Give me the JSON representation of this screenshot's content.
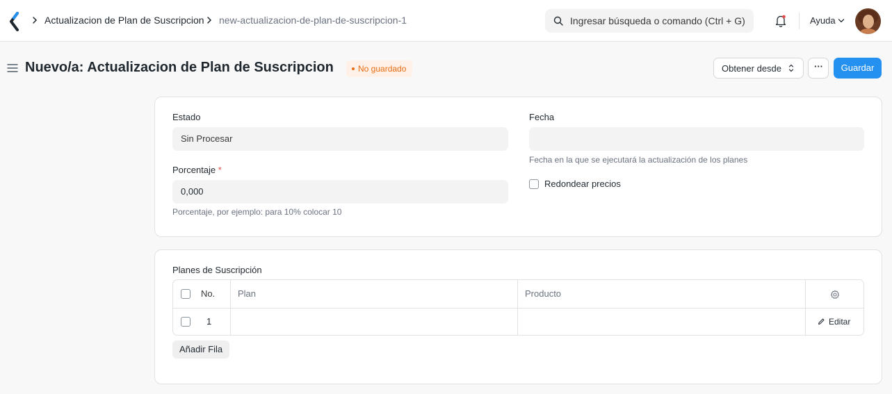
{
  "navbar": {
    "breadcrumbs": [
      "Actualizacion de Plan de Suscripcion",
      "new-actualizacion-de-plan-de-suscripcion-1"
    ],
    "search_placeholder": "Ingresar búsqueda o comando (Ctrl + G)",
    "help_label": "Ayuda"
  },
  "page": {
    "title": "Nuevo/a: Actualizacion de Plan de Suscripcion",
    "status_badge": "No guardado",
    "get_from_label": "Obtener desde",
    "more_label": "···",
    "save_label": "Guardar"
  },
  "form": {
    "estado_label": "Estado",
    "estado_value": "Sin Procesar",
    "porcentaje_label": "Porcentaje",
    "porcentaje_required": "*",
    "porcentaje_value": "0,000",
    "porcentaje_help": "Porcentaje, por ejemplo: para 10% colocar 10",
    "fecha_label": "Fecha",
    "fecha_value": "",
    "fecha_help": "Fecha en la que se ejecutará la actualización de los planes",
    "redondear_label": "Redondear precios",
    "redondear_checked": false
  },
  "table": {
    "section_label": "Planes de Suscripción",
    "columns": [
      "No.",
      "Plan",
      "Producto"
    ],
    "rows": [
      {
        "no": "1",
        "plan": "",
        "producto": ""
      }
    ],
    "edit_label": "Editar",
    "add_row_label": "Añadir Fila"
  },
  "colors": {
    "primary": "#2490ef",
    "warning": "#e86c13",
    "required": "#e24c4c"
  }
}
